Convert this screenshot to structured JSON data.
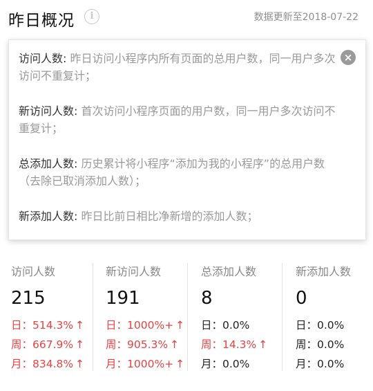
{
  "header": {
    "title": "昨日概况",
    "info_icon": "info-icon",
    "update_text": "数据更新至2018-07-22"
  },
  "popup": {
    "close_icon": "close-icon",
    "definitions": [
      {
        "term": "访问人数:",
        "desc": "昨日访问小程序内所有页面的总用户数，同一用户多次访问不重复计；"
      },
      {
        "term": "新访问人数:",
        "desc": "首次访问小程序页面的用户数，同一用户多次访问不重复计；"
      },
      {
        "term": "总添加人数:",
        "desc": "历史累计将小程序“添加为我的小程序”的总用户数（去除已取消添加人数）；"
      },
      {
        "term": "新添加人数:",
        "desc": "昨日比前日相比净新增的添加人数；"
      }
    ]
  },
  "colors": {
    "up": "#e64340",
    "neutral": "#222222",
    "label": "#888888"
  },
  "stats": [
    {
      "label": "访问人数",
      "value": "215",
      "rates": [
        {
          "text": "日：514.3%",
          "arrow": "↑",
          "trend": "up"
        },
        {
          "text": "周：667.9%",
          "arrow": "↑",
          "trend": "up"
        },
        {
          "text": "月：834.8%",
          "arrow": "↑",
          "trend": "up"
        }
      ]
    },
    {
      "label": "新访问人数",
      "value": "191",
      "rates": [
        {
          "text": "日：1000%+",
          "arrow": "↑",
          "trend": "up"
        },
        {
          "text": "周：905.3%",
          "arrow": "↑",
          "trend": "up"
        },
        {
          "text": "月：1000%+",
          "arrow": "↑",
          "trend": "up"
        }
      ]
    },
    {
      "label": "总添加人数",
      "value": "8",
      "rates": [
        {
          "text": "日：0.0%",
          "arrow": "",
          "trend": "flat"
        },
        {
          "text": "周：14.3%",
          "arrow": "↑",
          "trend": "up"
        },
        {
          "text": "月：0.0%",
          "arrow": "",
          "trend": "flat"
        }
      ]
    },
    {
      "label": "新添加人数",
      "value": "0",
      "rates": [
        {
          "text": "日：0.0%",
          "arrow": "",
          "trend": "flat"
        },
        {
          "text": "周：0.0%",
          "arrow": "",
          "trend": "flat"
        },
        {
          "text": "月：0.0%",
          "arrow": "",
          "trend": "flat"
        }
      ]
    }
  ]
}
